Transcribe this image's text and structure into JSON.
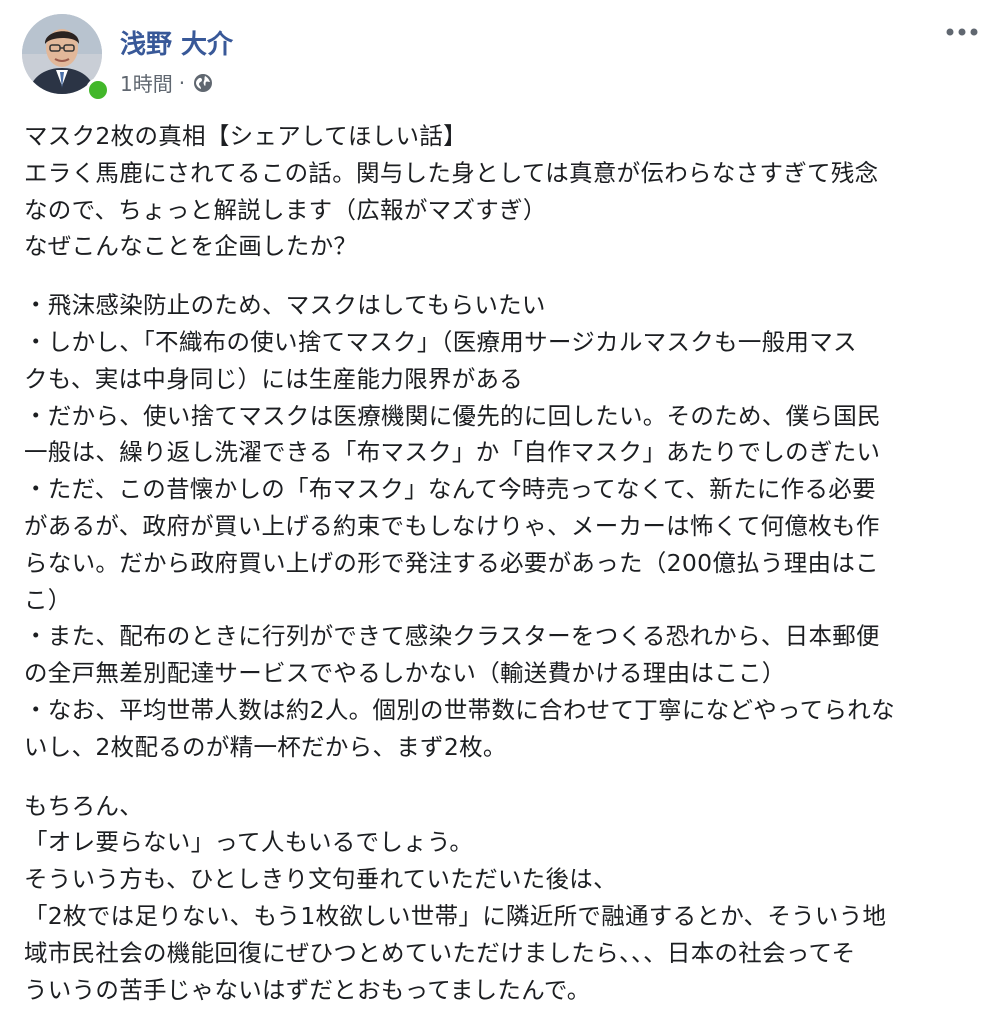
{
  "post": {
    "author": "浅野 大介",
    "time": "1時間",
    "separator": "·",
    "icons": {
      "more": "more-options-icon",
      "privacy": "globe-icon",
      "status": "online-status-dot"
    },
    "colors": {
      "name": "#385898",
      "meta": "#606770",
      "text": "#1c1e21",
      "online": "#42b72a"
    },
    "paragraphs": [
      {
        "lines": [
          "マスク2枚の真相【シェアしてほしい話】",
          "エラく馬鹿にされてるこの話。関与した身としては真意が伝わらなさすぎて残念",
          "なので、ちょっと解説します（広報がマズすぎ）",
          "なぜこんなことを企画したか？"
        ]
      },
      {
        "lines": [
          "・飛沫感染防止のため、マスクはしてもらいたい",
          "・しかし、「不織布の使い捨てマスク」（医療用サージカルマスクも一般用マス",
          "クも、実は中身同じ）には生産能力限界がある",
          "・だから、使い捨てマスクは医療機関に優先的に回したい。そのため、僕ら国民",
          "一般は、繰り返し洗濯できる「布マスク」か「自作マスク」あたりでしのぎたい",
          "・ただ、この昔懐かしの「布マスク」なんて今時売ってなくて、新たに作る必要",
          "があるが、政府が買い上げる約束でもしなけりゃ、メーカーは怖くて何億枚も作",
          "らない。だから政府買い上げの形で発注する必要があった（200億払う理由はこ",
          "こ）",
          "・また、配布のときに行列ができて感染クラスターをつくる恐れから、日本郵便",
          "の全戸無差別配達サービスでやるしかない（輸送費かける理由はここ）",
          "・なお、平均世帯人数は約2人。個別の世帯数に合わせて丁寧になどやってられな",
          "いし、2枚配るのが精一杯だから、まず2枚。"
        ]
      },
      {
        "lines": [
          "もちろん、",
          "「オレ要らない」って人もいるでしょう。",
          "そういう方も、ひとしきり文句垂れていただいた後は、",
          "「2枚では足りない、もう1枚欲しい世帯」に隣近所で融通するとか、そういう地",
          "域市民社会の機能回復にぜひつとめていただけましたら、、、日本の社会ってそ",
          "ういうの苦手じゃないはずだとおもってましたんで。"
        ]
      }
    ]
  }
}
